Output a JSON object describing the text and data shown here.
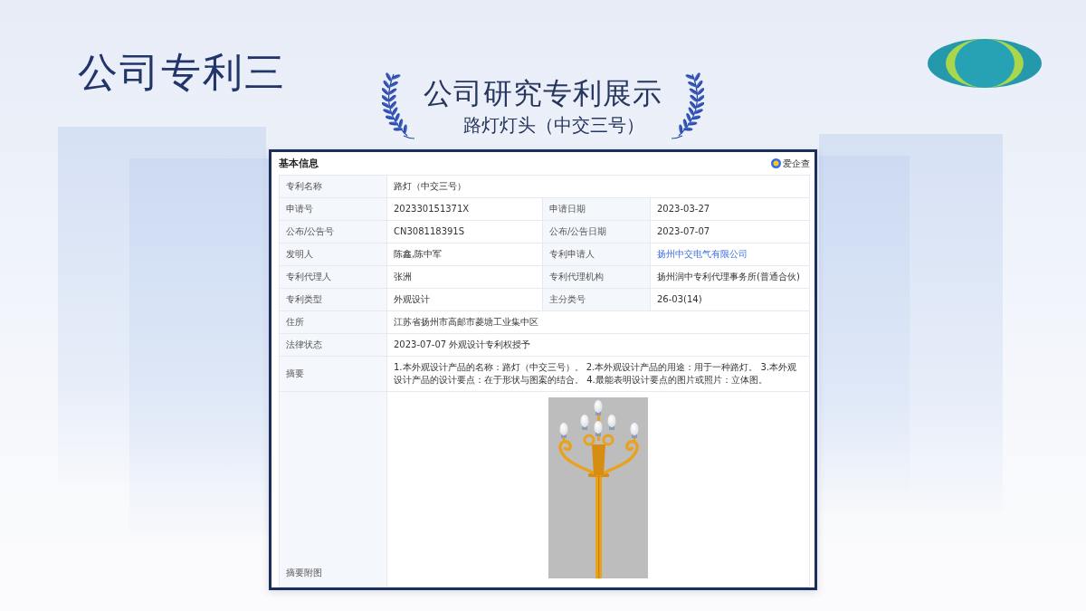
{
  "slide": {
    "title": "公司专利三"
  },
  "banner": {
    "title": "公司研究专利展示",
    "subtitle": "路灯灯头（中交三号）"
  },
  "card": {
    "heading": "基本信息",
    "brand": "爱企查",
    "rows": [
      {
        "kind": "single",
        "label": "专利名称",
        "value": "路灯（中交三号）"
      },
      {
        "kind": "pair",
        "cells": [
          {
            "label": "申请号",
            "value": "202330151371X",
            "link": false
          },
          {
            "label": "申请日期",
            "value": "2023-03-27",
            "link": false
          }
        ]
      },
      {
        "kind": "pair",
        "cells": [
          {
            "label": "公布/公告号",
            "value": "CN308118391S",
            "link": false
          },
          {
            "label": "公布/公告日期",
            "value": "2023-07-07",
            "link": false
          }
        ]
      },
      {
        "kind": "pair",
        "cells": [
          {
            "label": "发明人",
            "value": "陈鑫,陈中军",
            "link": false
          },
          {
            "label": "专利申请人",
            "value": "扬州中交电气有限公司",
            "link": true
          }
        ]
      },
      {
        "kind": "pair",
        "cells": [
          {
            "label": "专利代理人",
            "value": "张洲",
            "link": false
          },
          {
            "label": "专利代理机构",
            "value": "扬州润中专利代理事务所(普通合伙)",
            "link": false
          }
        ]
      },
      {
        "kind": "pair",
        "cells": [
          {
            "label": "专利类型",
            "value": "外观设计",
            "link": false
          },
          {
            "label": "主分类号",
            "value": "26-03(14)",
            "link": false
          }
        ]
      },
      {
        "kind": "single",
        "label": "住所",
        "value": "江苏省扬州市高邮市菱塘工业集中区"
      },
      {
        "kind": "single",
        "label": "法律状态",
        "value": "2023-07-07 外观设计专利权授予"
      },
      {
        "kind": "single",
        "label": "摘要",
        "value": "1.本外观设计产品的名称：路灯（中交三号）。 2.本外观设计产品的用途：用于一种路灯。 3.本外观设计产品的设计要点：在于形状与图案的结合。 4.最能表明设计要点的图片或照片：立体图。"
      },
      {
        "kind": "image",
        "label": "摘要附图"
      }
    ]
  }
}
